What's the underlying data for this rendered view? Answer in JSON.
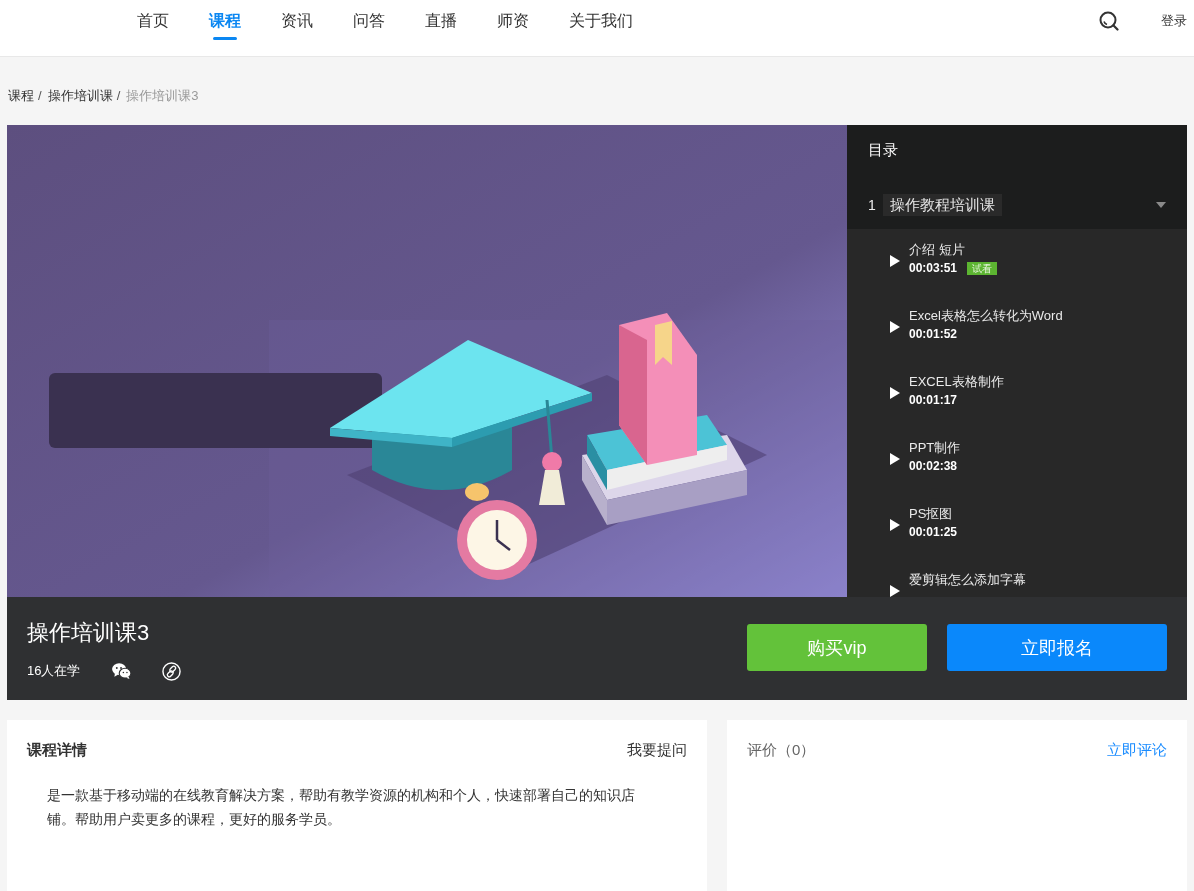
{
  "nav": {
    "items": [
      {
        "label": "首页",
        "selected": false
      },
      {
        "label": "课程",
        "selected": true
      },
      {
        "label": "资讯",
        "selected": false
      },
      {
        "label": "问答",
        "selected": false
      },
      {
        "label": "直播",
        "selected": false
      },
      {
        "label": "师资",
        "selected": false
      },
      {
        "label": "关于我们",
        "selected": false
      }
    ],
    "login": "登录"
  },
  "breadcrumb": {
    "separator": "/",
    "items": [
      {
        "label": "课程",
        "current": false
      },
      {
        "label": "操作培训课",
        "current": false
      },
      {
        "label": "操作培训课3",
        "current": true
      }
    ]
  },
  "catalog": {
    "title": "目录",
    "chapters": [
      {
        "number": "1",
        "title": "操作教程培训课",
        "expanded": true,
        "lessons": [
          {
            "title": "介绍 短片",
            "duration": "00:03:51",
            "badge": "试看"
          },
          {
            "title": "Excel表格怎么转化为Word",
            "duration": "00:01:52"
          },
          {
            "title": "EXCEL表格制作",
            "duration": "00:01:17"
          },
          {
            "title": "PPT制作",
            "duration": "00:02:38"
          },
          {
            "title": "PS抠图",
            "duration": "00:01:25"
          },
          {
            "title": "爱剪辑怎么添加字幕"
          }
        ]
      }
    ]
  },
  "course": {
    "title": "操作培训课3",
    "learners": "16人在学",
    "buttons": [
      {
        "label": "购买vip",
        "kind": "vip"
      },
      {
        "label": "立即报名",
        "kind": "enroll"
      }
    ]
  },
  "details": {
    "title": "课程详情",
    "action": "我要提问",
    "description": "是一款基于移动端的在线教育解决方案，帮助有教学资源的机构和个人，快速部署自己的知识店铺。帮助用户卖更多的课程，更好的服务学员。"
  },
  "reviews": {
    "title": "评价（0）",
    "action": "立即评论"
  }
}
